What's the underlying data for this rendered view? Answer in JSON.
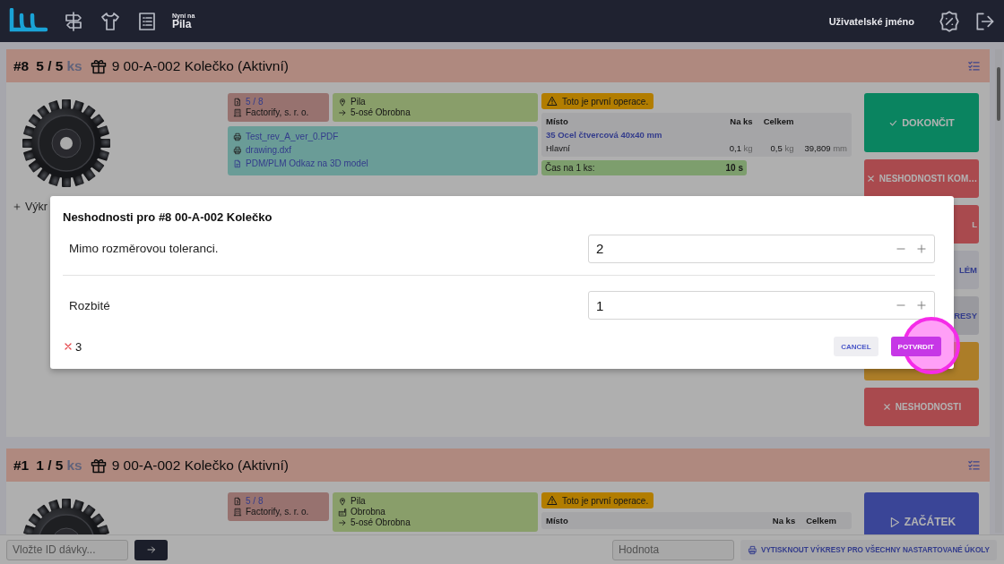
{
  "header": {
    "now_label": "Nyní na",
    "now_value": "Pila",
    "username": "Uživatelské jméno"
  },
  "tasks": [
    {
      "number": "#8",
      "count": "5 / 5",
      "unit": "ks",
      "title": "9 00-A-002 Kolečko (Aktivní)",
      "batch": "5 / 8",
      "company": "Factorify, s. r. o.",
      "route": [
        {
          "kind": "location",
          "text": "Pila"
        },
        {
          "kind": "next",
          "text": "5-osé Obrobna"
        }
      ],
      "files": [
        {
          "kind": "print",
          "text": "Test_rev_A_ver_0.PDF"
        },
        {
          "kind": "print",
          "text": "drawing.dxf"
        },
        {
          "kind": "model",
          "text": "PDM/PLM Odkaz na 3D model"
        }
      ],
      "warning": "Toto je první operace.",
      "materials": {
        "columns": [
          "Místo",
          "Na ks",
          "Celkem"
        ],
        "rows": [
          {
            "kind": "link",
            "name": "35 Ocel čtvercová 40x40 mm"
          },
          {
            "kind": "plain",
            "name": "Hlavní",
            "per_piece": "0,1",
            "per_piece_unit": "kg",
            "total": "0,5",
            "total_unit": "kg",
            "length": "39,809",
            "length_unit": "mm"
          }
        ]
      },
      "time": {
        "label": "Čas na 1 ks:",
        "value": "10 s"
      },
      "add_label": "Výkr",
      "actions": [
        {
          "kind": "done",
          "label": "DOKONČIT"
        },
        {
          "kind": "defect",
          "label": "NESHODNOSTI KOM…"
        },
        {
          "kind": "danger",
          "label": "L"
        },
        {
          "kind": "light",
          "label": "LÉM"
        },
        {
          "kind": "muted",
          "label": "RESY"
        },
        {
          "kind": "warning"
        },
        {
          "kind": "defect",
          "label": "NESHODNOSTI"
        }
      ]
    },
    {
      "number": "#1",
      "count": "1 / 5",
      "unit": "ks",
      "title": "9 00-A-002 Kolečko (Aktivní)",
      "batch": "5 / 8",
      "company": "Factorify, s. r. o.",
      "route": [
        {
          "kind": "location",
          "text": "Pila"
        },
        {
          "kind": "workplace",
          "text": "Obrobna"
        },
        {
          "kind": "next",
          "text": "5-osé Obrobna"
        }
      ],
      "warning": "Toto je první operace.",
      "materials": {
        "columns": [
          "Místo",
          "Na ks",
          "Celkem"
        ]
      },
      "actions": [
        {
          "kind": "start",
          "label": "ZAČÁTEK"
        }
      ]
    }
  ],
  "modal": {
    "title": "Neshodnosti pro  #8 00-A-002 Kolečko",
    "fields": [
      {
        "label": "Mimo rozměrovou toleranci.",
        "value": "2"
      },
      {
        "label": "Rozbité",
        "value": "1"
      }
    ],
    "total": "3",
    "cancel": "CANCEL",
    "confirm": {
      "label": "POTVRDIT",
      "touch_marker": true
    }
  },
  "bottom_bar": {
    "batch_placeholder": "Vložte ID dávky...",
    "value_placeholder": "Hodnota",
    "print_label": "VYTISKNOUT VÝKRESY PRO VŠECHNY NASTARTOVANÉ ÚKOLY"
  }
}
